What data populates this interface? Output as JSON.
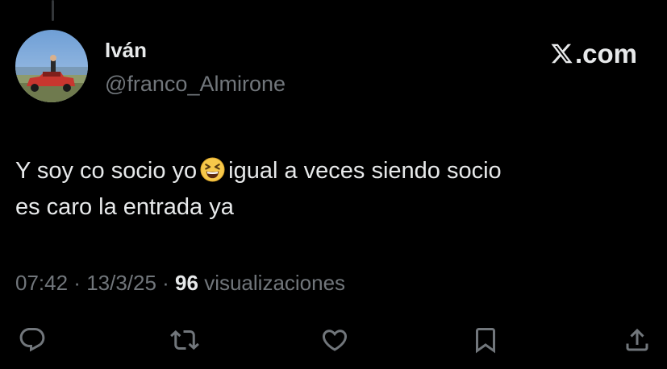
{
  "author": {
    "name": "Iván",
    "handle": "@franco_Almirone",
    "avatar": "profile-photo-person-on-red-pickup-by-lake"
  },
  "brand": {
    "text": ".com",
    "icon": "x-logo-icon"
  },
  "tweet": {
    "line1_before_emoji": "Y soy co socio yo",
    "emoji": "grinning-squinting-face-emoji",
    "line1_after_emoji": "igual a veces siendo socio",
    "line2": "es caro la entrada ya"
  },
  "meta": {
    "time": "07:42",
    "separator1": " · ",
    "date": "13/3/25",
    "separator2": " · ",
    "views_count": "96",
    "views_label": " visualizaciones"
  },
  "actions": [
    {
      "name": "reply",
      "icon": "reply-icon"
    },
    {
      "name": "retweet",
      "icon": "retweet-icon"
    },
    {
      "name": "like",
      "icon": "heart-icon"
    },
    {
      "name": "bookmark",
      "icon": "bookmark-icon"
    },
    {
      "name": "share",
      "icon": "share-icon"
    }
  ],
  "colors": {
    "background": "#000000",
    "primary_text": "#e7e9ea",
    "secondary_text": "#71767b",
    "thread_line": "#333639"
  }
}
